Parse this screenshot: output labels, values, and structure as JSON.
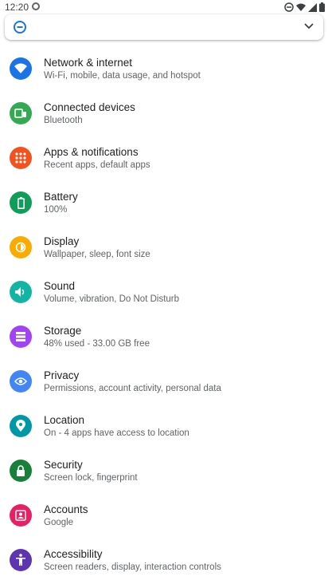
{
  "status": {
    "time": "12:20",
    "icons": [
      "sync-icon",
      "do-not-disturb-icon",
      "wifi-icon",
      "signal-icon",
      "battery-icon"
    ]
  },
  "search": {
    "left_icon": "minus-circle-icon",
    "right_icon": "chevron-down-icon"
  },
  "items": [
    {
      "title": "Network & internet",
      "subtitle": "Wi-Fi, mobile, data usage, and hotspot",
      "icon": "wifi-icon",
      "color": "#1a73e8"
    },
    {
      "title": "Connected devices",
      "subtitle": "Bluetooth",
      "icon": "devices-icon",
      "color": "#34a853"
    },
    {
      "title": "Apps & notifications",
      "subtitle": "Recent apps, default apps",
      "icon": "apps-grid-icon",
      "color": "#f4511e"
    },
    {
      "title": "Battery",
      "subtitle": "100%",
      "icon": "battery-icon",
      "color": "#0f9d58"
    },
    {
      "title": "Display",
      "subtitle": "Wallpaper, sleep, font size",
      "icon": "brightness-icon",
      "color": "#f9ab00"
    },
    {
      "title": "Sound",
      "subtitle": "Volume, vibration, Do Not Disturb",
      "icon": "volume-icon",
      "color": "#12b5a4"
    },
    {
      "title": "Storage",
      "subtitle": "48% used - 33.00 GB free",
      "icon": "storage-icon",
      "color": "#a142f4"
    },
    {
      "title": "Privacy",
      "subtitle": "Permissions, account activity, personal data",
      "icon": "eye-icon",
      "color": "#4285f4"
    },
    {
      "title": "Location",
      "subtitle": "On - 4 apps have access to location",
      "icon": "location-pin-icon",
      "color": "#0097a7"
    },
    {
      "title": "Security",
      "subtitle": "Screen lock, fingerprint",
      "icon": "lock-icon",
      "color": "#188038"
    },
    {
      "title": "Accounts",
      "subtitle": "Google",
      "icon": "account-icon",
      "color": "#e91e63"
    },
    {
      "title": "Accessibility",
      "subtitle": "Screen readers, display, interaction controls",
      "icon": "accessibility-icon",
      "color": "#5e35b1"
    }
  ]
}
